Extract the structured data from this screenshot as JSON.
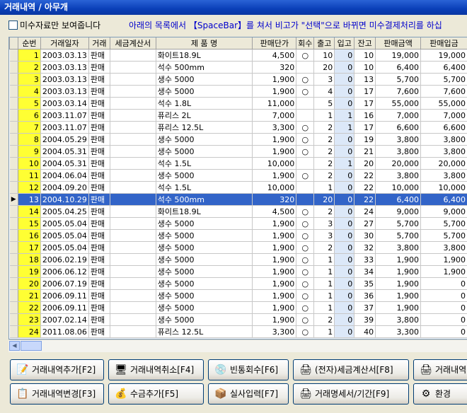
{
  "window": {
    "title": "거래내역 / 아무개"
  },
  "filter": {
    "checkbox_label": "미수자료만 보여줍니다",
    "notice": "아래의 목록에서 【SpaceBar】를 쳐서 비고가 \"선택\"으로 바뀌면 미수결제처리를 하십"
  },
  "table": {
    "columns": [
      "순번",
      "거래일자",
      "거래",
      "세금계산서",
      "제 품 명",
      "판매단가",
      "회수",
      "출고",
      "입고",
      "잔고",
      "판매금액",
      "판매입금"
    ],
    "selected_row_index": 12,
    "rows": [
      {
        "seq": "1",
        "date": "2003.03.13",
        "type": "판매",
        "invoice": "",
        "product": "화이트18.9L",
        "price": "4,500",
        "ret": "○",
        "out": "10",
        "in": "0",
        "bal": "10",
        "amount": "19,000",
        "paid": "19,000"
      },
      {
        "seq": "2",
        "date": "2003.03.13",
        "type": "판매",
        "invoice": "",
        "product": "석수 500mm",
        "price": "320",
        "ret": "",
        "out": "20",
        "in": "0",
        "bal": "10",
        "amount": "6,400",
        "paid": "6,400"
      },
      {
        "seq": "3",
        "date": "2003.03.13",
        "type": "판매",
        "invoice": "",
        "product": "생수 5000",
        "price": "1,900",
        "ret": "○",
        "out": "3",
        "in": "0",
        "bal": "13",
        "amount": "5,700",
        "paid": "5,700"
      },
      {
        "seq": "4",
        "date": "2003.03.13",
        "type": "판매",
        "invoice": "",
        "product": "생수 5000",
        "price": "1,900",
        "ret": "○",
        "out": "4",
        "in": "0",
        "bal": "17",
        "amount": "7,600",
        "paid": "7,600"
      },
      {
        "seq": "5",
        "date": "2003.03.14",
        "type": "판매",
        "invoice": "",
        "product": "석수 1.8L",
        "price": "11,000",
        "ret": "",
        "out": "5",
        "in": "0",
        "bal": "17",
        "amount": "55,000",
        "paid": "55,000"
      },
      {
        "seq": "6",
        "date": "2003.11.07",
        "type": "판매",
        "invoice": "",
        "product": "퓨리스 2L",
        "price": "7,000",
        "ret": "",
        "out": "1",
        "in": "1",
        "bal": "16",
        "amount": "7,000",
        "paid": "7,000"
      },
      {
        "seq": "7",
        "date": "2003.11.07",
        "type": "판매",
        "invoice": "",
        "product": "퓨리스 12.5L",
        "price": "3,300",
        "ret": "○",
        "out": "2",
        "in": "1",
        "bal": "17",
        "amount": "6,600",
        "paid": "6,600"
      },
      {
        "seq": "8",
        "date": "2004.05.29",
        "type": "판매",
        "invoice": "",
        "product": "생수 5000",
        "price": "1,900",
        "ret": "○",
        "out": "2",
        "in": "0",
        "bal": "19",
        "amount": "3,800",
        "paid": "3,800"
      },
      {
        "seq": "9",
        "date": "2004.05.31",
        "type": "판매",
        "invoice": "",
        "product": "생수 5000",
        "price": "1,900",
        "ret": "○",
        "out": "2",
        "in": "0",
        "bal": "21",
        "amount": "3,800",
        "paid": "3,800"
      },
      {
        "seq": "10",
        "date": "2004.05.31",
        "type": "판매",
        "invoice": "",
        "product": "석수 1.5L",
        "price": "10,000",
        "ret": "",
        "out": "2",
        "in": "1",
        "bal": "20",
        "amount": "20,000",
        "paid": "20,000"
      },
      {
        "seq": "11",
        "date": "2004.06.04",
        "type": "판매",
        "invoice": "",
        "product": "생수 5000",
        "price": "1,900",
        "ret": "○",
        "out": "2",
        "in": "0",
        "bal": "22",
        "amount": "3,800",
        "paid": "3,800"
      },
      {
        "seq": "12",
        "date": "2004.09.20",
        "type": "판매",
        "invoice": "",
        "product": "석수 1.5L",
        "price": "10,000",
        "ret": "",
        "out": "1",
        "in": "0",
        "bal": "22",
        "amount": "10,000",
        "paid": "10,000"
      },
      {
        "seq": "13",
        "date": "2004.10.29",
        "type": "판매",
        "invoice": "",
        "product": "석수 500mm",
        "price": "320",
        "ret": "",
        "out": "20",
        "in": "0",
        "bal": "22",
        "amount": "6,400",
        "paid": "6,400"
      },
      {
        "seq": "14",
        "date": "2005.04.25",
        "type": "판매",
        "invoice": "",
        "product": "화이트18.9L",
        "price": "4,500",
        "ret": "○",
        "out": "2",
        "in": "0",
        "bal": "24",
        "amount": "9,000",
        "paid": "9,000"
      },
      {
        "seq": "15",
        "date": "2005.05.04",
        "type": "판매",
        "invoice": "",
        "product": "생수 5000",
        "price": "1,900",
        "ret": "○",
        "out": "3",
        "in": "0",
        "bal": "27",
        "amount": "5,700",
        "paid": "5,700"
      },
      {
        "seq": "16",
        "date": "2005.05.04",
        "type": "판매",
        "invoice": "",
        "product": "생수 5000",
        "price": "1,900",
        "ret": "○",
        "out": "3",
        "in": "0",
        "bal": "30",
        "amount": "5,700",
        "paid": "5,700"
      },
      {
        "seq": "17",
        "date": "2005.05.04",
        "type": "판매",
        "invoice": "",
        "product": "생수 5000",
        "price": "1,900",
        "ret": "○",
        "out": "2",
        "in": "0",
        "bal": "32",
        "amount": "3,800",
        "paid": "3,800"
      },
      {
        "seq": "18",
        "date": "2006.02.19",
        "type": "판매",
        "invoice": "",
        "product": "생수 5000",
        "price": "1,900",
        "ret": "○",
        "out": "1",
        "in": "0",
        "bal": "33",
        "amount": "1,900",
        "paid": "1,900"
      },
      {
        "seq": "19",
        "date": "2006.06.12",
        "type": "판매",
        "invoice": "",
        "product": "생수 5000",
        "price": "1,900",
        "ret": "○",
        "out": "1",
        "in": "0",
        "bal": "34",
        "amount": "1,900",
        "paid": "1,900"
      },
      {
        "seq": "20",
        "date": "2006.07.19",
        "type": "판매",
        "invoice": "",
        "product": "생수 5000",
        "price": "1,900",
        "ret": "○",
        "out": "1",
        "in": "0",
        "bal": "35",
        "amount": "1,900",
        "paid": "0"
      },
      {
        "seq": "21",
        "date": "2006.09.11",
        "type": "판매",
        "invoice": "",
        "product": "생수 5000",
        "price": "1,900",
        "ret": "○",
        "out": "1",
        "in": "0",
        "bal": "36",
        "amount": "1,900",
        "paid": "0"
      },
      {
        "seq": "22",
        "date": "2006.09.11",
        "type": "판매",
        "invoice": "",
        "product": "생수 5000",
        "price": "1,900",
        "ret": "○",
        "out": "1",
        "in": "0",
        "bal": "37",
        "amount": "1,900",
        "paid": "0"
      },
      {
        "seq": "23",
        "date": "2007.02.14",
        "type": "판매",
        "invoice": "",
        "product": "생수 5000",
        "price": "1,900",
        "ret": "○",
        "out": "2",
        "in": "0",
        "bal": "39",
        "amount": "3,800",
        "paid": "0"
      },
      {
        "seq": "24",
        "date": "2011.08.06",
        "type": "판매",
        "invoice": "",
        "product": "퓨리스 12.5L",
        "price": "3,300",
        "ret": "○",
        "out": "1",
        "in": "0",
        "bal": "40",
        "amount": "3,300",
        "paid": "0"
      }
    ]
  },
  "buttons": {
    "add_record": "거래내역추가[F2]",
    "cancel_record": "거래내역취소[F4]",
    "bottle_return": "빈통회수[F6]",
    "e_invoice": "(전자)세금계산서[F8]",
    "record_print": "거래내역",
    "edit_record": "거래내역변경[F3]",
    "add_payment": "수금추가[F5]",
    "actual_input": "실사입력[F7]",
    "statement_period": "거래명세서/기간[F9]",
    "settings": "환경"
  }
}
